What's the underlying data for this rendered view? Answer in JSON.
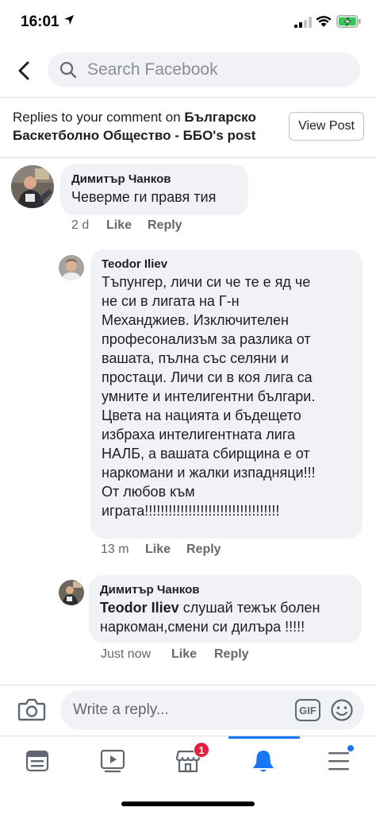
{
  "status_bar": {
    "time": "16:01"
  },
  "header": {
    "search_placeholder": "Search Facebook",
    "back_icon": "chevron-left-icon",
    "search_icon": "search-icon"
  },
  "context": {
    "prefix": "Replies to your comment on ",
    "page_name": "Българско Баскетболно Общество - ББО",
    "suffix": "'s post",
    "view_post_label": "View Post"
  },
  "comments": [
    {
      "author": "Димитър Чанков",
      "text": "Чеверме ги правя тия",
      "time": "2 d",
      "like_label": "Like",
      "reply_label": "Reply"
    },
    {
      "author": "Teodor Iliev",
      "lines": [
        "Тъпунгер, личи си че те е яд че",
        "не си в лигата на Г-н",
        "Механджиев. Изключителен",
        "професонализъм за разлика от",
        "вашата, пълна със селяни и",
        "простаци. Личи си в коя лига са",
        "умните и интелигентни българи.",
        "Цвета на нацията и бъдещето",
        "избраха интелигентната лига",
        "НАЛБ, а вашата сбирщина е от",
        "наркомани и жалки изпадняци!!!",
        "От любов към",
        "играта!!!!!!!!!!!!!!!!!!!!!!!!!!!!!!!!!!"
      ],
      "time": "13 m",
      "like_label": "Like",
      "reply_label": "Reply"
    },
    {
      "author": "Димитър Чанков",
      "mention": "Teodor Iliev",
      "text_line1": " слушай тежък болен",
      "text_line2": "наркоман,смени си дилъра !!!!!",
      "time": "Just now",
      "like_label": "Like",
      "reply_label": "Reply"
    }
  ],
  "reply_bar": {
    "placeholder": "Write a reply...",
    "gif_label": "GIF",
    "camera_icon": "camera-icon",
    "emoji_icon": "emoji-icon"
  },
  "bottom_nav": {
    "items": [
      "news-feed-icon",
      "watch-icon",
      "marketplace-icon",
      "notifications-icon",
      "menu-icon"
    ],
    "marketplace_badge": "1",
    "active": "notifications-icon",
    "accent": "#1877f2"
  }
}
